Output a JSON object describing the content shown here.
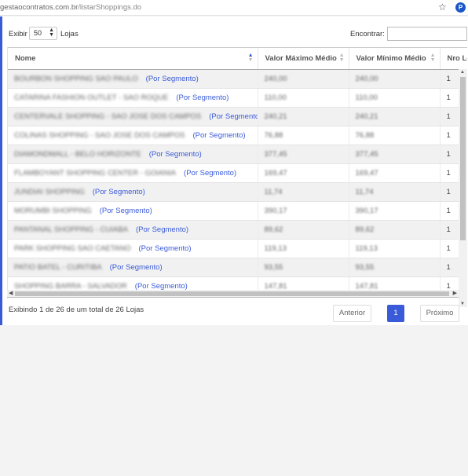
{
  "browser": {
    "url_host": "gestaocontratos.com.br",
    "url_path": "/listarShoppings.do",
    "profile_initial": "P",
    "star_icon": "☆"
  },
  "controls": {
    "length_label": "Exibir",
    "length_value": "50",
    "length_suffix": "Lojas",
    "search_label": "Encontrar:",
    "search_value": ""
  },
  "table": {
    "columns": [
      "Nome",
      "Valor Máximo Médio",
      "Valor Mínimo Médio",
      "Nro Lo"
    ],
    "link_label": "(Por Segmento)",
    "rows": [
      {
        "name": "BOURBON SHOPPING SAO PAULO",
        "max": "240,00",
        "min": "240,00",
        "nro": "1"
      },
      {
        "name": "CATARINA FASHION OUTLET - SAO ROQUE",
        "max": "110,00",
        "min": "110,00",
        "nro": "1"
      },
      {
        "name": "CENTERVALE SHOPPING - SAO JOSE DOS CAMPOS",
        "max": "240,21",
        "min": "240,21",
        "nro": "1"
      },
      {
        "name": "COLINAS SHOPPING - SAO JOSE DOS CAMPOS",
        "max": "76,88",
        "min": "76,88",
        "nro": "1"
      },
      {
        "name": "DIAMONDMALL - BELO HORIZONTE",
        "max": "377,45",
        "min": "377,45",
        "nro": "1"
      },
      {
        "name": "FLAMBOYANT SHOPPING CENTER - GOIANIA",
        "max": "169,47",
        "min": "169,47",
        "nro": "1"
      },
      {
        "name": "JUNDIAI SHOPPING",
        "max": "11,74",
        "min": "11,74",
        "nro": "1"
      },
      {
        "name": "MORUMBI SHOPPING",
        "max": "390,17",
        "min": "390,17",
        "nro": "1"
      },
      {
        "name": "PANTANAL SHOPPING - CUIABA",
        "max": "89,62",
        "min": "89,62",
        "nro": "1"
      },
      {
        "name": "PARK SHOPPING SAO CAETANO",
        "max": "119,13",
        "min": "119,13",
        "nro": "1"
      },
      {
        "name": "PATIO BATEL - CURITIBA",
        "max": "93,55",
        "min": "93,55",
        "nro": "1"
      },
      {
        "name": "SHOPPING BARRA - SALVADOR",
        "max": "147,81",
        "min": "147,81",
        "nro": "1"
      }
    ]
  },
  "footer": {
    "info": "Exibindo 1 de 26 de um total de 26 Lojas",
    "prev_label": "Anterior",
    "page_label": "1",
    "next_label": "Próximo"
  },
  "colors": {
    "accent": "#3a5bd9",
    "row_stripe": "#f1f1f1"
  }
}
